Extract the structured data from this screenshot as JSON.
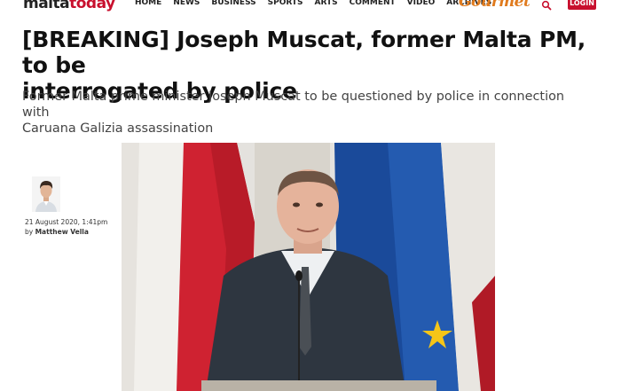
{
  "site": {
    "logo_part1": "malta",
    "logo_part2": "today",
    "nav_items": [
      "HOME",
      "NEWS",
      "BUSINESS",
      "SPORTS",
      "ARTS",
      "COMMENT",
      "VIDEO",
      "ARCHIVES"
    ],
    "gourmet_label": "Gourmet",
    "search_icon": "search-icon",
    "login_label": "LOGIN",
    "brand_color": "#c8102e"
  },
  "article": {
    "headline_line1": "[BREAKING] Joseph Muscat, former Malta PM, to be",
    "headline_line2": "interrogated by police",
    "subhead_line1": "Former Malta prime minister Joseph Muscat to be questioned by police in connection with",
    "subhead_line2": "Caruana Galizia assassination",
    "date": "21 August 2020, 1:41pm",
    "by_prefix": "by",
    "author": "Matthew Vella"
  }
}
